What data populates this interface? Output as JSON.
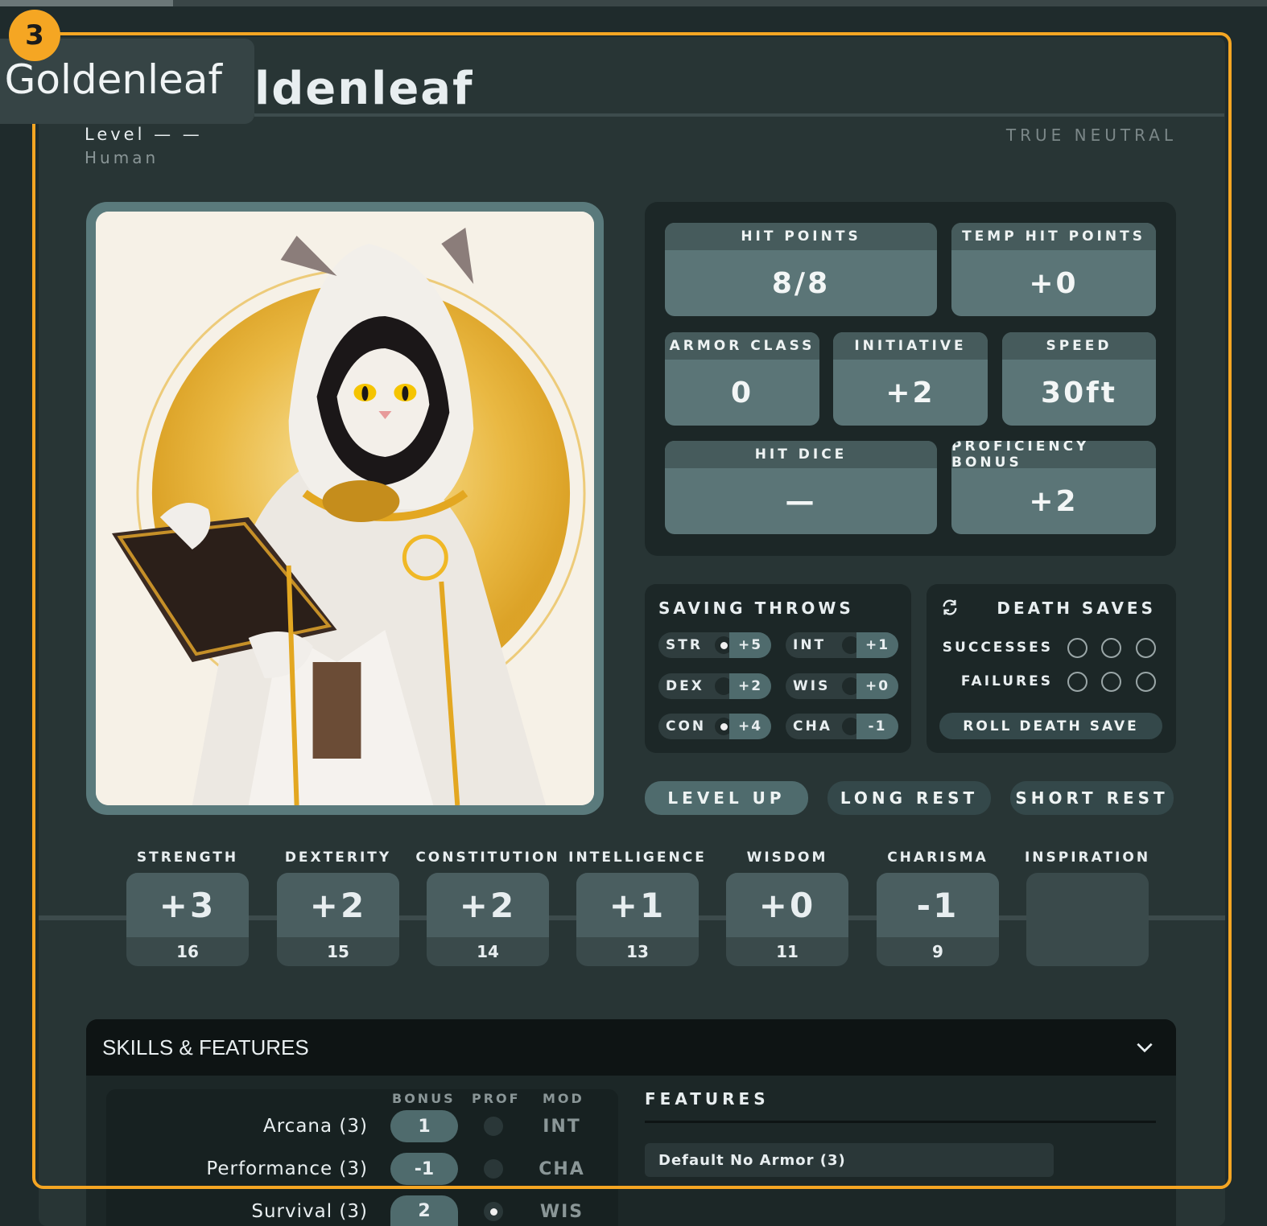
{
  "marker": {
    "number": "3"
  },
  "character": {
    "name_tooltip": "a Goldenleaf",
    "name_visible": "ldenleaf",
    "level": "Level — —",
    "race": "Human",
    "alignment": "TRUE NEUTRAL"
  },
  "stats": {
    "hit_points": {
      "label": "HIT POINTS",
      "value": "8/8"
    },
    "temp_hit_points": {
      "label": "TEMP HIT POINTS",
      "value": "+0"
    },
    "armor_class": {
      "label": "ARMOR CLASS",
      "value": "0"
    },
    "initiative": {
      "label": "INITIATIVE",
      "value": "+2"
    },
    "speed": {
      "label": "SPEED",
      "value": "30ft"
    },
    "hit_dice": {
      "label": "HIT DICE",
      "value": "—"
    },
    "proficiency_bonus": {
      "label": "PROFICIENCY BONUS",
      "value": "+2"
    }
  },
  "saving_throws": {
    "title": "SAVING THROWS",
    "items": [
      {
        "ability": "STR",
        "proficient": true,
        "bonus": "+5"
      },
      {
        "ability": "INT",
        "proficient": false,
        "bonus": "+1"
      },
      {
        "ability": "DEX",
        "proficient": false,
        "bonus": "+2"
      },
      {
        "ability": "WIS",
        "proficient": false,
        "bonus": "+0"
      },
      {
        "ability": "CON",
        "proficient": true,
        "bonus": "+4"
      },
      {
        "ability": "CHA",
        "proficient": false,
        "bonus": "-1"
      }
    ]
  },
  "death_saves": {
    "title": "DEATH SAVES",
    "successes_label": "SUCCESSES",
    "failures_label": "FAILURES",
    "successes": 0,
    "failures": 0,
    "roll_label": "ROLL DEATH SAVE"
  },
  "actions": {
    "level_up": "LEVEL UP",
    "long_rest": "LONG REST",
    "short_rest": "SHORT REST"
  },
  "abilities": [
    {
      "name": "STRENGTH",
      "mod": "+3",
      "score": "16"
    },
    {
      "name": "DEXTERITY",
      "mod": "+2",
      "score": "15"
    },
    {
      "name": "CONSTITUTION",
      "mod": "+2",
      "score": "14"
    },
    {
      "name": "INTELLIGENCE",
      "mod": "+1",
      "score": "13"
    },
    {
      "name": "WISDOM",
      "mod": "+0",
      "score": "11"
    },
    {
      "name": "CHARISMA",
      "mod": "-1",
      "score": "9"
    },
    {
      "name": "INSPIRATION",
      "mod": "",
      "score": ""
    }
  ],
  "skills_section": {
    "title": "SKILLS & FEATURES",
    "columns": {
      "bonus": "BONUS",
      "prof": "PROF",
      "mod": "MOD"
    },
    "skills": [
      {
        "name": "Arcana (3)",
        "bonus": "1",
        "proficient": false,
        "mod": "INT"
      },
      {
        "name": "Performance (3)",
        "bonus": "-1",
        "proficient": false,
        "mod": "CHA"
      },
      {
        "name": "Survival (3)",
        "bonus": "2",
        "proficient": true,
        "mod": "WIS"
      }
    ],
    "features_title": "FEATURES",
    "features": [
      "Default No Armor (3)"
    ]
  },
  "colors": {
    "accent_outline": "#f5a623",
    "panel": "#1c2727",
    "stat_value_bg": "#5b7577"
  }
}
